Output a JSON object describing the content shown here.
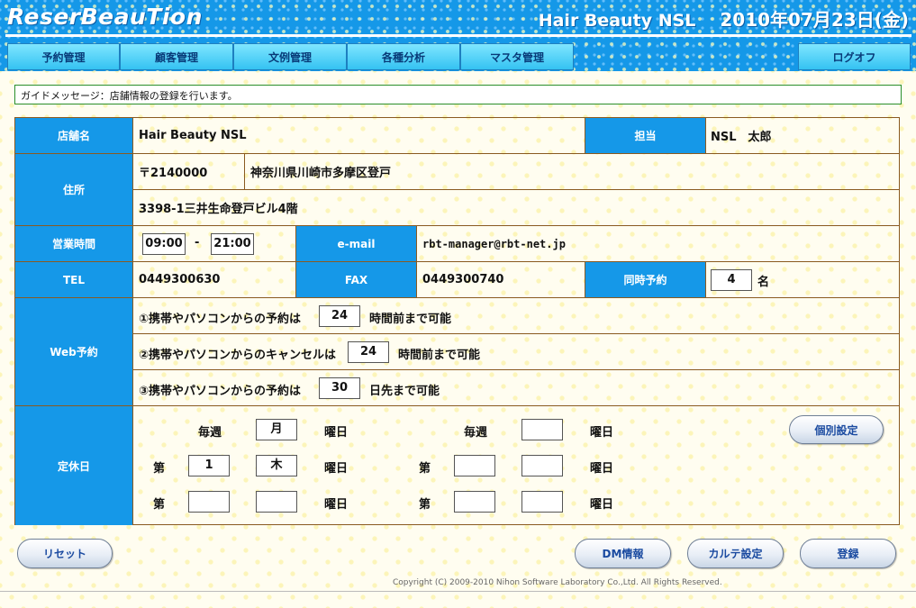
{
  "header": {
    "logo": "ReserBeauTion",
    "store": "Hair Beauty NSL",
    "date": "2010年07月23日(金)"
  },
  "nav": {
    "items": [
      "予約管理",
      "顧客管理",
      "文例管理",
      "各種分析",
      "マスタ管理"
    ],
    "logout": "ログオフ"
  },
  "guide": {
    "message": "ガイドメッセージ：店舗情報の登録を行います。"
  },
  "form": {
    "store_name_label": "店舗名",
    "store_name": "Hair Beauty NSL",
    "staff_label": "担当",
    "staff": "NSL　太郎",
    "address_label": "住所",
    "postal": "〒2140000",
    "address1": "神奈川県川崎市多摩区登戸",
    "address2": "3398-1三井生命登戸ビル4階",
    "hours_label": "営業時間",
    "open": "09:00",
    "dash": "-",
    "close": "21:00",
    "email_label": "e-mail",
    "email": "rbt-manager@rbt-net.jp",
    "tel_label": "TEL",
    "tel": "0449300630",
    "fax_label": "FAX",
    "fax": "0449300740",
    "simul_label": "同時予約",
    "simul_value": "4",
    "simul_unit": "名",
    "web_label": "Web予約",
    "web1_pre": "①携帯やパソコンからの予約は",
    "web1_value": "24",
    "web1_post": "時間前まで可能",
    "web2_pre": "②携帯やパソコンからのキャンセルは",
    "web2_value": "24",
    "web2_post": "時間前まで可能",
    "web3_pre": "③携帯やパソコンからの予約は",
    "web3_value": "30",
    "web3_post": "日先まで可能",
    "holiday_label": "定休日",
    "weekly": "毎週",
    "nth": "第",
    "youbi": "曜日",
    "weekly1_day": "月",
    "weekly2_day": "",
    "nth1_week": "1",
    "nth1_day": "木",
    "nth2_week": "",
    "nth2_day": "",
    "nth3_week": "",
    "nth3_day": "",
    "nth4_week": "",
    "nth4_day": "",
    "individual_button": "個別設定"
  },
  "buttons": {
    "reset": "リセット",
    "dm": "DM情報",
    "karte": "カルテ設定",
    "register": "登録"
  },
  "footer": {
    "copyright": "Copyright (C) 2009-2010 Nihon Software Laboratory Co.,Ltd. All Rights Reserved."
  },
  "colors": {
    "header_blue": "#1598e8",
    "tab_cyan": "#4fd0f5",
    "label_blue": "#1598e8",
    "button_text": "#1a4aa0"
  }
}
